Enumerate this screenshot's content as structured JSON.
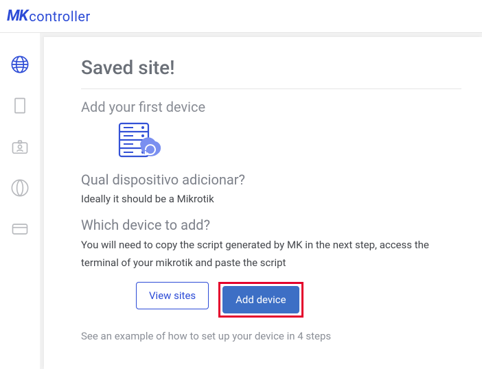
{
  "brand": {
    "mark": "MK",
    "text": "controller"
  },
  "sidebar": {
    "items": [
      {
        "name": "globe-icon",
        "active": true
      },
      {
        "name": "document-icon",
        "active": false
      },
      {
        "name": "id-badge-icon",
        "active": false
      },
      {
        "name": "circle-swirl-icon",
        "active": false
      },
      {
        "name": "card-icon",
        "active": false
      }
    ]
  },
  "main": {
    "title": "Saved site!",
    "subheading": "Add your first device",
    "q1_heading": "Qual dispositivo adicionar?",
    "q1_text": "Ideally it should be a Mikrotik",
    "q2_heading": "Which device to add?",
    "q2_text": "You will need to copy the script generated by MK in the next step, access the terminal of your mikrotik and paste the script",
    "buttons": {
      "view_sites": "View sites",
      "add_device": "Add device"
    },
    "footer_link": "See an example of how to set up your device in 4 steps"
  }
}
